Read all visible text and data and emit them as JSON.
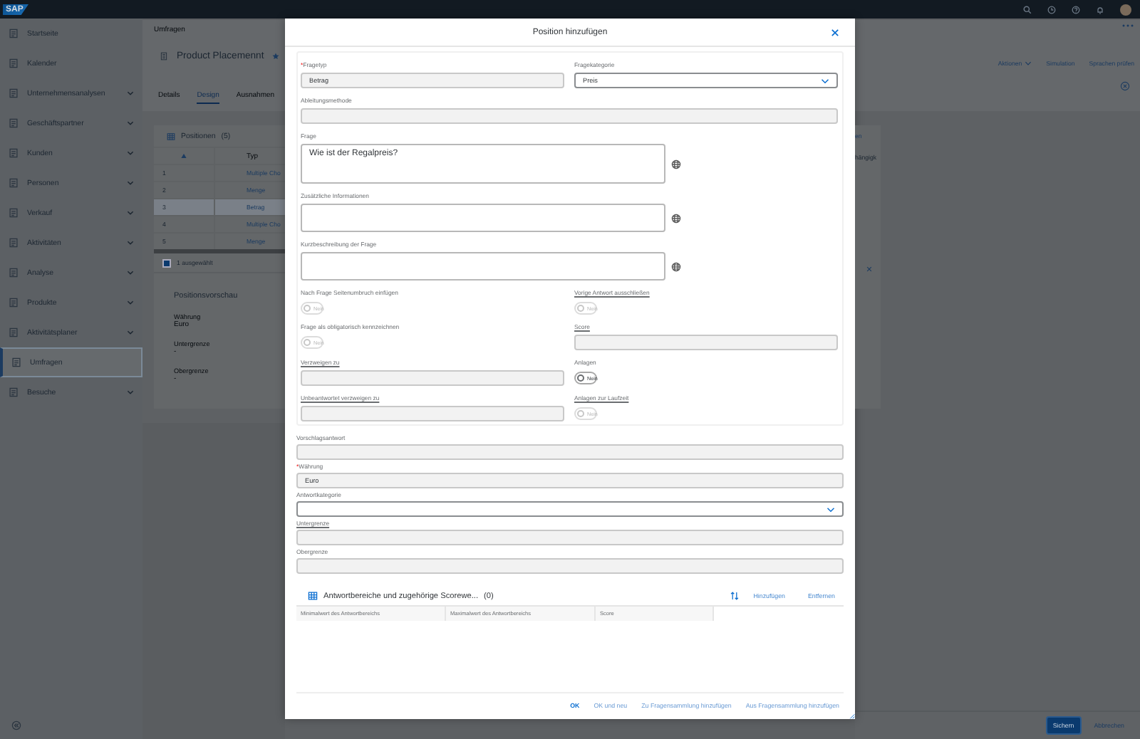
{
  "shell": {
    "logo": "SAP"
  },
  "sidebar": {
    "items": [
      {
        "label": "Startseite",
        "expandable": false,
        "selected": false
      },
      {
        "label": "Kalender",
        "expandable": false,
        "selected": false
      },
      {
        "label": "Unternehmensanalysen",
        "expandable": true,
        "selected": false
      },
      {
        "label": "Geschäftspartner",
        "expandable": true,
        "selected": false
      },
      {
        "label": "Kunden",
        "expandable": true,
        "selected": false
      },
      {
        "label": "Personen",
        "expandable": true,
        "selected": false
      },
      {
        "label": "Verkauf",
        "expandable": true,
        "selected": false
      },
      {
        "label": "Aktivitäten",
        "expandable": true,
        "selected": false
      },
      {
        "label": "Analyse",
        "expandable": true,
        "selected": false
      },
      {
        "label": "Produkte",
        "expandable": true,
        "selected": false
      },
      {
        "label": "Aktivitätsplaner",
        "expandable": true,
        "selected": false
      },
      {
        "label": "Umfragen",
        "expandable": false,
        "selected": true
      },
      {
        "label": "Besuche",
        "expandable": true,
        "selected": false
      }
    ]
  },
  "page": {
    "breadcrumb": "Umfragen",
    "title": "Product Placemennt",
    "favorite": true,
    "actions": [
      {
        "label": "Aktionen",
        "menu": true
      },
      {
        "label": "Simulation",
        "menu": false
      },
      {
        "label": "Sprachen prüfen",
        "menu": false
      }
    ],
    "tabs": [
      {
        "label": "Details",
        "selected": false
      },
      {
        "label": "Design",
        "selected": true
      },
      {
        "label": "Ausnahmen",
        "selected": false
      }
    ],
    "positions": {
      "title": "Positionen",
      "count": "(5)",
      "column": "Typ",
      "header_fragment": "en",
      "column_fragment": "hängigk",
      "rows": [
        {
          "number": "1",
          "type": "Multiple Cho",
          "selected": false
        },
        {
          "number": "2",
          "type": "Menge",
          "selected": false
        },
        {
          "number": "3",
          "type": "Betrag",
          "selected": true
        },
        {
          "number": "4",
          "type": "Multiple Cho",
          "selected": false
        },
        {
          "number": "5",
          "type": "Menge",
          "selected": false
        }
      ],
      "selection": {
        "text": "1 ausgewählt",
        "checked": true
      },
      "preview": {
        "title": "Positionsvorschau",
        "fields": [
          {
            "label": "Währung",
            "value": "Euro"
          },
          {
            "label": "Untergrenze",
            "value": "-"
          },
          {
            "label": "Obergrenze",
            "value": "-"
          }
        ]
      }
    }
  },
  "dialog": {
    "title": "Position hinzufügen",
    "form": [
      {
        "fields": [
          {
            "label": "Fragetyp",
            "required_mark": "*",
            "underlined": false,
            "kind": "input",
            "disabled": true,
            "value": "Betrag"
          },
          {
            "label": "Fragekategorie",
            "underlined": false,
            "kind": "select",
            "disabled": false,
            "value": "Preis"
          }
        ]
      },
      {
        "fields": [
          {
            "label": "Ableitungsmethode",
            "underlined": false,
            "kind": "input",
            "disabled": true
          }
        ]
      },
      {
        "fields": [
          {
            "label": "Frage",
            "underlined": false,
            "kind": "textarea",
            "disabled": false,
            "value": "Wie ist der Regalpreis?",
            "translatable": true
          }
        ]
      },
      {
        "fields": [
          {
            "label": "Zusätzliche Informationen",
            "underlined": false,
            "kind": "textarea",
            "disabled": false,
            "translatable": true
          }
        ]
      },
      {
        "fields": [
          {
            "label": "Kurzbeschreibung der Frage",
            "underlined": false,
            "kind": "textarea",
            "disabled": false,
            "translatable": true
          }
        ]
      },
      {
        "fields": [
          {
            "label": "Nach Frage Seitenumbruch einfügen",
            "underlined": false,
            "kind": "toggle",
            "disabled": true,
            "on": false,
            "value": "Nein"
          },
          {
            "label": "Vorige Antwort ausschließen",
            "underlined": true,
            "kind": "toggle",
            "disabled": true,
            "on": false,
            "value": "Nein"
          }
        ]
      },
      {
        "fields": [
          {
            "label": "Frage als obligatorisch kennzeichnen",
            "underlined": false,
            "kind": "toggle",
            "disabled": true,
            "on": false,
            "value": "Nein"
          },
          {
            "label": "Score",
            "underlined": true,
            "kind": "input",
            "disabled": true
          }
        ]
      },
      {
        "fields": [
          {
            "label": "Verzweigen zu",
            "underlined": true,
            "kind": "input",
            "disabled": true
          },
          {
            "label": "Anlagen",
            "underlined": false,
            "kind": "toggle",
            "disabled": false,
            "on": false,
            "value": "Nein"
          }
        ]
      },
      {
        "fields": [
          {
            "label": "Unbeantwortet verzweigen zu",
            "underlined": true,
            "kind": "input",
            "disabled": true
          },
          {
            "label": "Anlagen zur Laufzeit",
            "underlined": true,
            "kind": "toggle",
            "disabled": true,
            "on": false,
            "value": "Nein"
          }
        ]
      }
    ],
    "answer_fields": [
      {
        "label": "Vorschlagsantwort",
        "underlined": false,
        "kind": "input",
        "disabled": true
      },
      {
        "label": "Währung",
        "required_mark": "*",
        "underlined": false,
        "kind": "input",
        "disabled": true,
        "value": "Euro"
      },
      {
        "label": "Antwortkategorie",
        "underlined": false,
        "kind": "select",
        "disabled": false
      },
      {
        "label": "Untergrenze",
        "underlined": true,
        "kind": "input",
        "disabled": true
      },
      {
        "label": "Obergrenze",
        "underlined": false,
        "kind": "input",
        "disabled": true
      }
    ],
    "table": {
      "title": "Antwortbereiche und zugehörige Scorewe...",
      "count": "(0)",
      "actions": [
        "Hinzufügen",
        "Entfernen"
      ],
      "columns": [
        "Minimalwert des Antwortbereichs",
        "Maximalwert des Antwortbereichs",
        "Score"
      ]
    },
    "buttons": [
      {
        "label": "OK",
        "emphasized": true
      },
      {
        "label": "OK und neu",
        "emphasized": false
      },
      {
        "label": "Zu Fragensammlung hinzufügen",
        "emphasized": false
      },
      {
        "label": "Aus Fragensammlung hinzufügen",
        "emphasized": false
      }
    ]
  },
  "footer": {
    "buttons": [
      {
        "label": "Sichern",
        "emphasized": true
      },
      {
        "label": "Abbrechen",
        "emphasized": false
      }
    ]
  }
}
